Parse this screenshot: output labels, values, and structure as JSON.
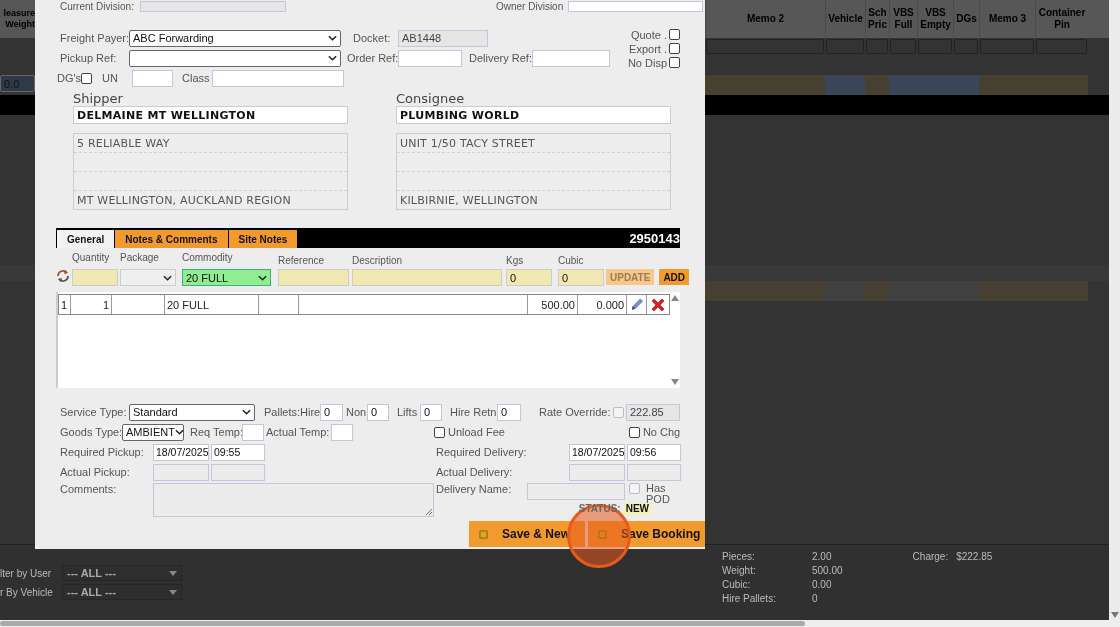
{
  "background": {
    "left_heading": [
      "leasure",
      "Weight"
    ],
    "columns": [
      {
        "label": "Memo 2"
      },
      {
        "label": "Vehicle"
      },
      {
        "label": "Sch Pric"
      },
      {
        "label": "VBS Full"
      },
      {
        "label": "VBS Empty"
      },
      {
        "label": "DGs"
      },
      {
        "label": "Memo 3"
      },
      {
        "label": "Container Pin"
      }
    ],
    "rows": [
      {
        "value": "0.0",
        "cells": [
          {
            "color": "#474030"
          },
          {
            "color": "#3a4658"
          },
          {
            "color": "#474030"
          },
          {
            "color": "#3a4658"
          },
          {
            "color": "#3a4658"
          },
          {
            "color": "#3a4658"
          },
          {
            "color": "#474030"
          },
          {
            "color": "#474030"
          }
        ]
      },
      {
        "cells": [
          {
            "color": "#474030"
          },
          {
            "color": "#404040"
          },
          {
            "color": "#474030"
          },
          {
            "color": "#404040"
          },
          {
            "color": "#404040"
          },
          {
            "color": "#404040"
          },
          {
            "color": "#474030"
          },
          {
            "color": "#474030"
          }
        ]
      }
    ],
    "filters": [
      {
        "label": "lter by User",
        "value": "--- ALL ---"
      },
      {
        "label": "r By Vehicle",
        "value": "--- ALL ---"
      }
    ],
    "totals": [
      {
        "label": "Pieces:",
        "value": "2.00"
      },
      {
        "label": "Weight:",
        "value": "500.00"
      },
      {
        "label": "Cubic:",
        "value": "0.00"
      },
      {
        "label": "Hire Pallets:",
        "value": "0"
      }
    ],
    "charge": {
      "label": "Charge:",
      "value": "$222.85"
    }
  },
  "booking": {
    "current_division_label": "Current Division:",
    "owner_division_label": "Owner Division",
    "freight_payer": {
      "label": "Freight Payer:",
      "value": "ABC Forwarding"
    },
    "pickup_ref": {
      "label": "Pickup Ref:"
    },
    "docket": {
      "label": "Docket:",
      "value": "AB1448",
      "disabled": true
    },
    "order_ref": {
      "label": "Order Ref:"
    },
    "delivery_ref": {
      "label": "Delivery Ref:"
    },
    "flags": [
      {
        "label": "Quote .",
        "checked": false
      },
      {
        "label": "Export .",
        "checked": false
      },
      {
        "label": "No Disp",
        "checked": false
      }
    ],
    "dgs": {
      "label": "DG's",
      "checked": false
    },
    "un": {
      "label": "UN"
    },
    "class": {
      "label": "Class"
    },
    "parties": [
      {
        "heading": "Shipper",
        "name": "DELMAINE MT WELLINGTON",
        "address_first": "5 RELIABLE WAY",
        "address_last": "MT WELLINGTON, AUCKLAND REGION"
      },
      {
        "heading": "Consignee",
        "name": "PLUMBING WORLD",
        "address_first": "UNIT 1/50 TACY STREET",
        "address_last": "KILBIRNIE, WELLINGTON"
      }
    ],
    "tabs": [
      {
        "label": "General",
        "selected": true
      },
      {
        "label": "Notes & Comments",
        "selected": false
      },
      {
        "label": "Site Notes",
        "selected": false
      }
    ],
    "booking_number": "2950143",
    "entry": {
      "labels": [
        "Quantity",
        "Package",
        "Commodity",
        "Reference",
        "Description",
        "Kgs",
        "Cubic"
      ],
      "commodity": "20 FULL",
      "kgs": "0",
      "cubic": "0",
      "buttons": [
        {
          "label": "UPDATE",
          "disabled": true
        },
        {
          "label": "ADD",
          "disabled": false
        }
      ]
    },
    "items": [
      {
        "line": "1",
        "quantity": "1",
        "commodity": "20 FULL",
        "kgs": "500.00",
        "cubic": "0.000"
      }
    ],
    "service_type": {
      "label": "Service Type:",
      "value": "Standard"
    },
    "pallets_hire": {
      "label": "Pallets:Hire",
      "value": "0"
    },
    "pallets_non": {
      "label": "Non",
      "value": "0"
    },
    "lifts": {
      "label": "Lifts",
      "value": "0"
    },
    "hire_retn": {
      "label": "Hire Retn",
      "value": "0"
    },
    "rate_override": {
      "label": "Rate Override:",
      "checked": false,
      "value": "222.85",
      "disabled": true
    },
    "goods_type": {
      "label": "Goods Type:",
      "value": "AMBIENT"
    },
    "req_temp": {
      "label": "Req Temp:"
    },
    "actual_temp": {
      "label": "Actual Temp:"
    },
    "unload_fee": {
      "label": "Unload Fee",
      "checked": false
    },
    "no_chg": {
      "label": "No Chg",
      "checked": false
    },
    "required_pickup": {
      "label": "Required Pickup:",
      "date": "18/07/2025",
      "time": "09:55"
    },
    "actual_pickup": {
      "label": "Actual Pickup:"
    },
    "comments": {
      "label": "Comments:"
    },
    "required_delivery": {
      "label": "Required Delivery:",
      "date": "18/07/2025",
      "time": "09:56"
    },
    "actual_delivery": {
      "label": "Actual Delivery:"
    },
    "delivery_name": {
      "label": "Delivery Name:"
    },
    "has_pod": {
      "label": "Has POD",
      "checked": false,
      "disabled": true
    },
    "status": {
      "label": "STATUS:",
      "value": "NEW"
    },
    "buttons": [
      {
        "label": "Save & New"
      },
      {
        "label": "Save Booking"
      }
    ]
  }
}
